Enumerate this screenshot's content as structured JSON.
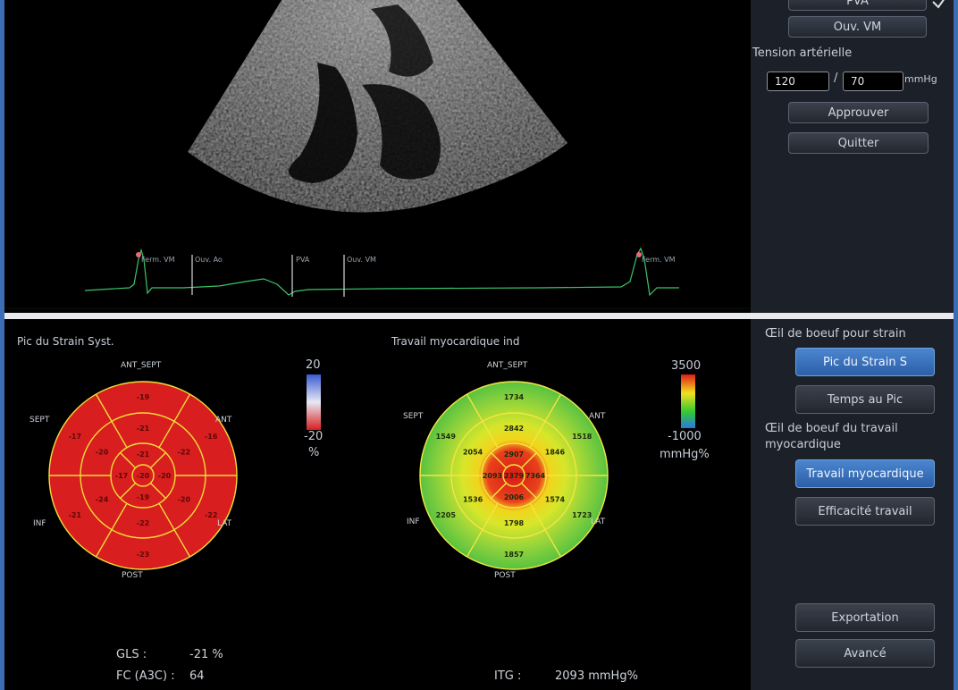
{
  "top_panel": {
    "buttons": {
      "pva": "PVA",
      "ouv_vm": "Ouv. VM",
      "approve": "Approuver",
      "quit": "Quitter"
    },
    "bp_label": "Tension artérielle",
    "bp_systolic": "120",
    "bp_separator": "/",
    "bp_diastolic": "70",
    "bp_unit": "mmHg",
    "ecg_markers": [
      "Ferm. VM",
      "Ouv. Ao",
      "PVA",
      "Ouv. VM",
      "Ferm. VM"
    ]
  },
  "strain_map": {
    "title": "Pic du Strain Syst.",
    "fill_color": "#d81e1e",
    "orientation": {
      "top": "ANT_SEPT",
      "upper_right": "ANT",
      "upper_left": "SEPT",
      "lower_left": "INF",
      "lower_right": "LAT",
      "bottom": "POST"
    },
    "segments": {
      "basal": [
        "-19",
        "-16",
        "-22",
        "-23",
        "-21",
        "-17"
      ],
      "mid": [
        "-21",
        "-22",
        "-20",
        "-22",
        "-24",
        "-20"
      ],
      "apical": [
        "-21",
        "-20",
        "-19",
        "-17"
      ],
      "apex": "-20"
    },
    "scale": {
      "max": "20",
      "min": "-20",
      "unit": "%",
      "colors": [
        "#3a5bd1",
        "#e8e8f4",
        "#d81e1e"
      ]
    },
    "gls_label": "GLS :",
    "gls_value": "-21 %",
    "fc_label": "FC (A3C) :",
    "fc_value": "64"
  },
  "work_map": {
    "title": "Travail myocardique ind",
    "orientation": {
      "top": "ANT_SEPT",
      "upper_right": "ANT",
      "upper_left": "SEPT",
      "lower_left": "INF",
      "lower_right": "LAT",
      "bottom": "POST"
    },
    "segments": {
      "basal": [
        "1734",
        "1518",
        "1723",
        "1857",
        "2205",
        "1549"
      ],
      "mid": [
        "2842",
        "1846",
        "1574",
        "1798",
        "1536",
        "2054"
      ],
      "apical": [
        "2907",
        "7364",
        "2006",
        "2093"
      ],
      "apex": "2379"
    },
    "scale": {
      "max": "3500",
      "min": "-1000",
      "unit": "mmHg%",
      "colors": [
        "#e01c1c",
        "#f2e11d",
        "#32c832",
        "#2a78e4"
      ]
    },
    "itg_label": "ITG :",
    "itg_value": "2093 mmHg%"
  },
  "right_panel": {
    "strain_section_label": "Œil de boeuf pour strain",
    "peak_strain_button": "Pic du Strain S",
    "time_to_peak_button": "Temps au Pic",
    "work_section_label": "Œil de boeuf du travail myocardique",
    "work_button": "Travail myocardique",
    "efficiency_button": "Efficacité travail",
    "export_button": "Exportation",
    "advanced_button": "Avancé"
  }
}
